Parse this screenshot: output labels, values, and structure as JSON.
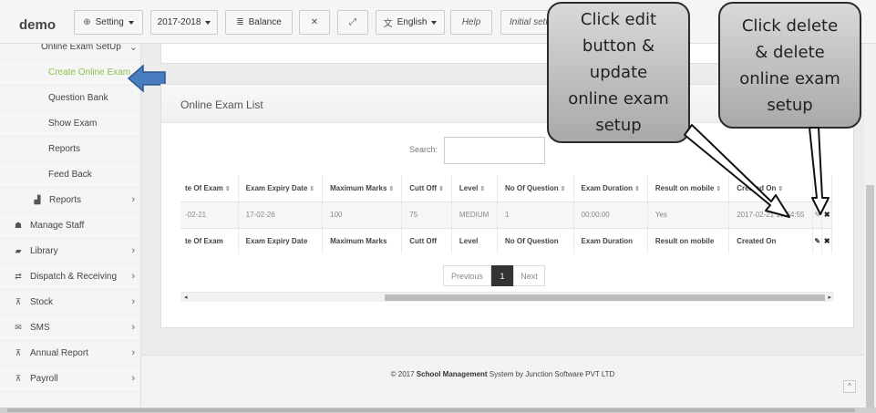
{
  "app": {
    "brand": "demo"
  },
  "topbar": {
    "setting": "Setting",
    "year": "2017-2018",
    "balance": "Balance",
    "language": "English",
    "help": "Help",
    "initial_setup": "Initial setu"
  },
  "sidebar": {
    "items": [
      {
        "label": "Online Exam SetUp"
      },
      {
        "label": "Create Online Exam"
      },
      {
        "label": "Question Bank"
      },
      {
        "label": "Show Exam"
      },
      {
        "label": "Reports"
      },
      {
        "label": "Feed Back"
      },
      {
        "label": "Reports"
      },
      {
        "label": "Manage Staff"
      },
      {
        "label": "Library"
      },
      {
        "label": "Dispatch & Receiving"
      },
      {
        "label": "Stock"
      },
      {
        "label": "SMS"
      },
      {
        "label": "Annual Report"
      },
      {
        "label": "Payroll"
      }
    ]
  },
  "panel": {
    "title": "Online Exam List"
  },
  "search": {
    "label": "Search:"
  },
  "table": {
    "columns": [
      "te Of Exam",
      "Exam Expiry Date",
      "Maximum Marks",
      "Cutt Off",
      "Level",
      "No Of Question",
      "Exam Duration",
      "Result on mobile",
      "Created On"
    ],
    "row": [
      "-02-21",
      "17-02-26",
      "100",
      "75",
      "MEDIUM",
      "1",
      "00:00:00",
      "Yes",
      "2017-02-21 10:54:55"
    ]
  },
  "pagination": {
    "previous": "Previous",
    "current": "1",
    "next": "Next"
  },
  "footer": {
    "prefix": "© 2017 ",
    "bold": "School Management",
    "suffix": " System by Junction Software PVT LTD"
  },
  "callouts": {
    "edit": [
      "Click edit",
      "button &",
      "update",
      "online exam",
      "setup"
    ],
    "delete": [
      "Click delete",
      "& delete",
      "online exam",
      "setup"
    ]
  },
  "colors": {
    "active": "#8cc14c",
    "arrow": "#4a7cc0"
  }
}
